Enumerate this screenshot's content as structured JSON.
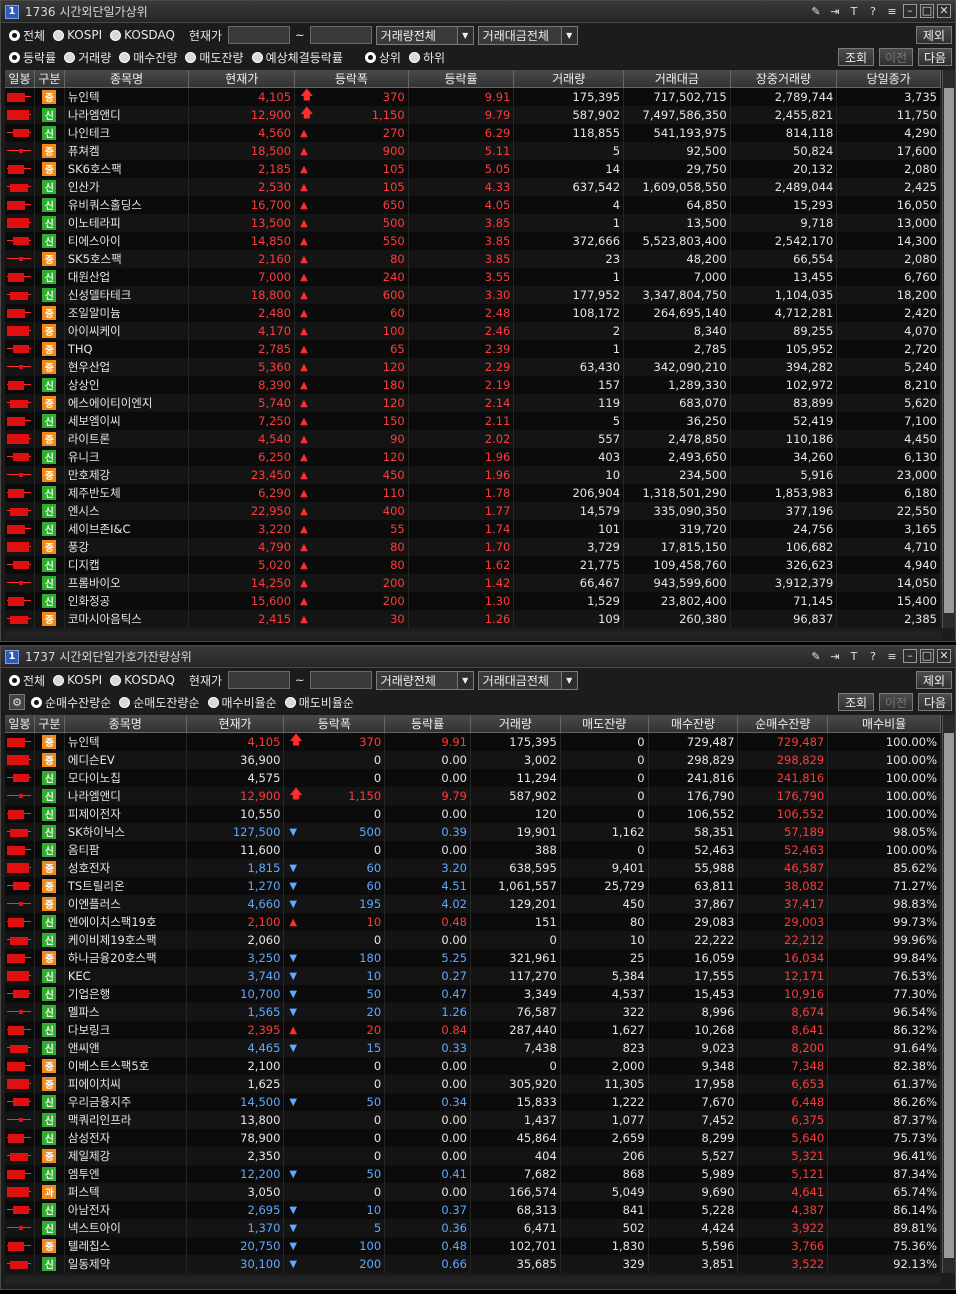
{
  "w1": {
    "title_num": "1",
    "title": "1736 시간외단일가상위",
    "market_options": [
      "전체",
      "KOSPI",
      "KOSDAQ"
    ],
    "price_label": "현재가",
    "range_sep": "~",
    "volume_select": "거래량전체",
    "amount_select": "거래대금전체",
    "exclude_btn": "제외",
    "sort_options": [
      "등락률",
      "거래량",
      "매수잔량",
      "매도잔량",
      "예상체결등락률"
    ],
    "dir_options": [
      "상위",
      "하위"
    ],
    "query_btn": "조회",
    "prev_btn": "이전",
    "next_btn": "다음",
    "headers": [
      "일봉",
      "구분",
      "종목명",
      "현재가",
      "등락폭",
      "등락률",
      "거래량",
      "거래대금",
      "장중거래량",
      "당일종가"
    ],
    "rows": [
      {
        "b": "증",
        "name": "뉴인텍",
        "price": "4,105",
        "arrow": "up",
        "chg": "370",
        "rate": "9.91",
        "vol": "175,395",
        "amt": "717,502,715",
        "dvol": "2,789,744",
        "close": "3,735"
      },
      {
        "b": "신",
        "name": "나라엠앤디",
        "price": "12,900",
        "arrow": "up",
        "chg": "1,150",
        "rate": "9.79",
        "vol": "587,902",
        "amt": "7,497,586,350",
        "dvol": "2,455,821",
        "close": "11,750"
      },
      {
        "b": "신",
        "name": "나인테크",
        "price": "4,560",
        "arrow": "tri",
        "chg": "270",
        "rate": "6.29",
        "vol": "118,855",
        "amt": "541,193,975",
        "dvol": "814,118",
        "close": "4,290"
      },
      {
        "b": "증",
        "name": "퓨쳐켐",
        "price": "18,500",
        "arrow": "tri",
        "chg": "900",
        "rate": "5.11",
        "vol": "5",
        "amt": "92,500",
        "dvol": "50,824",
        "close": "17,600"
      },
      {
        "b": "증",
        "name": "SK6호스팩",
        "price": "2,185",
        "arrow": "tri",
        "chg": "105",
        "rate": "5.05",
        "vol": "14",
        "amt": "29,750",
        "dvol": "20,132",
        "close": "2,080"
      },
      {
        "b": "신",
        "name": "인산가",
        "price": "2,530",
        "arrow": "tri",
        "chg": "105",
        "rate": "4.33",
        "vol": "637,542",
        "amt": "1,609,058,550",
        "dvol": "2,489,044",
        "close": "2,425"
      },
      {
        "b": "신",
        "name": "유비쿼스홀딩스",
        "price": "16,700",
        "arrow": "tri",
        "chg": "650",
        "rate": "4.05",
        "vol": "4",
        "amt": "64,850",
        "dvol": "15,293",
        "close": "16,050"
      },
      {
        "b": "신",
        "name": "이노테라피",
        "price": "13,500",
        "arrow": "tri",
        "chg": "500",
        "rate": "3.85",
        "vol": "1",
        "amt": "13,500",
        "dvol": "9,718",
        "close": "13,000"
      },
      {
        "b": "신",
        "name": "티에스아이",
        "price": "14,850",
        "arrow": "tri",
        "chg": "550",
        "rate": "3.85",
        "vol": "372,666",
        "amt": "5,523,803,400",
        "dvol": "2,542,170",
        "close": "14,300"
      },
      {
        "b": "증",
        "name": "SK5호스팩",
        "price": "2,160",
        "arrow": "tri",
        "chg": "80",
        "rate": "3.85",
        "vol": "23",
        "amt": "48,200",
        "dvol": "66,554",
        "close": "2,080"
      },
      {
        "b": "신",
        "name": "대원산업",
        "price": "7,000",
        "arrow": "tri",
        "chg": "240",
        "rate": "3.55",
        "vol": "1",
        "amt": "7,000",
        "dvol": "13,455",
        "close": "6,760"
      },
      {
        "b": "신",
        "name": "신성델타테크",
        "price": "18,800",
        "arrow": "tri",
        "chg": "600",
        "rate": "3.30",
        "vol": "177,952",
        "amt": "3,347,804,750",
        "dvol": "1,104,035",
        "close": "18,200"
      },
      {
        "b": "증",
        "name": "조일알미늄",
        "price": "2,480",
        "arrow": "tri",
        "chg": "60",
        "rate": "2.48",
        "vol": "108,172",
        "amt": "264,695,140",
        "dvol": "4,712,281",
        "close": "2,420"
      },
      {
        "b": "증",
        "name": "아이씨케이",
        "price": "4,170",
        "arrow": "tri",
        "chg": "100",
        "rate": "2.46",
        "vol": "2",
        "amt": "8,340",
        "dvol": "89,255",
        "close": "4,070"
      },
      {
        "b": "증",
        "name": "THQ",
        "price": "2,785",
        "arrow": "tri",
        "chg": "65",
        "rate": "2.39",
        "vol": "1",
        "amt": "2,785",
        "dvol": "105,952",
        "close": "2,720"
      },
      {
        "b": "증",
        "name": "현우산업",
        "price": "5,360",
        "arrow": "tri",
        "chg": "120",
        "rate": "2.29",
        "vol": "63,430",
        "amt": "342,090,210",
        "dvol": "394,282",
        "close": "5,240"
      },
      {
        "b": "신",
        "name": "상상인",
        "price": "8,390",
        "arrow": "tri",
        "chg": "180",
        "rate": "2.19",
        "vol": "157",
        "amt": "1,289,330",
        "dvol": "102,972",
        "close": "8,210"
      },
      {
        "b": "증",
        "name": "에스에이티이엔지",
        "price": "5,740",
        "arrow": "tri",
        "chg": "120",
        "rate": "2.14",
        "vol": "119",
        "amt": "683,070",
        "dvol": "83,899",
        "close": "5,620"
      },
      {
        "b": "신",
        "name": "세보엠이씨",
        "price": "7,250",
        "arrow": "tri",
        "chg": "150",
        "rate": "2.11",
        "vol": "5",
        "amt": "36,250",
        "dvol": "52,419",
        "close": "7,100"
      },
      {
        "b": "증",
        "name": "라이트론",
        "price": "4,540",
        "arrow": "tri",
        "chg": "90",
        "rate": "2.02",
        "vol": "557",
        "amt": "2,478,850",
        "dvol": "110,186",
        "close": "4,450"
      },
      {
        "b": "신",
        "name": "유니크",
        "price": "6,250",
        "arrow": "tri",
        "chg": "120",
        "rate": "1.96",
        "vol": "403",
        "amt": "2,493,650",
        "dvol": "34,260",
        "close": "6,130"
      },
      {
        "b": "증",
        "name": "만호제강",
        "price": "23,450",
        "arrow": "tri",
        "chg": "450",
        "rate": "1.96",
        "vol": "10",
        "amt": "234,500",
        "dvol": "5,916",
        "close": "23,000"
      },
      {
        "b": "신",
        "name": "제주반도체",
        "price": "6,290",
        "arrow": "tri",
        "chg": "110",
        "rate": "1.78",
        "vol": "206,904",
        "amt": "1,318,501,290",
        "dvol": "1,853,983",
        "close": "6,180"
      },
      {
        "b": "신",
        "name": "엔시스",
        "price": "22,950",
        "arrow": "tri",
        "chg": "400",
        "rate": "1.77",
        "vol": "14,579",
        "amt": "335,090,350",
        "dvol": "377,196",
        "close": "22,550"
      },
      {
        "b": "신",
        "name": "세이브존I&C",
        "price": "3,220",
        "arrow": "tri",
        "chg": "55",
        "rate": "1.74",
        "vol": "101",
        "amt": "319,720",
        "dvol": "24,756",
        "close": "3,165"
      },
      {
        "b": "증",
        "name": "풍강",
        "price": "4,790",
        "arrow": "tri",
        "chg": "80",
        "rate": "1.70",
        "vol": "3,729",
        "amt": "17,815,150",
        "dvol": "106,682",
        "close": "4,710"
      },
      {
        "b": "신",
        "name": "디지캡",
        "price": "5,020",
        "arrow": "tri",
        "chg": "80",
        "rate": "1.62",
        "vol": "21,775",
        "amt": "109,458,760",
        "dvol": "326,623",
        "close": "4,940"
      },
      {
        "b": "신",
        "name": "프롬바이오",
        "price": "14,250",
        "arrow": "tri",
        "chg": "200",
        "rate": "1.42",
        "vol": "66,467",
        "amt": "943,599,600",
        "dvol": "3,912,379",
        "close": "14,050"
      },
      {
        "b": "신",
        "name": "인화정공",
        "price": "15,600",
        "arrow": "tri",
        "chg": "200",
        "rate": "1.30",
        "vol": "1,529",
        "amt": "23,802,400",
        "dvol": "71,145",
        "close": "15,400"
      },
      {
        "b": "증",
        "name": "코마시아음틱스",
        "price": "2,415",
        "arrow": "tri",
        "chg": "30",
        "rate": "1.26",
        "vol": "109",
        "amt": "260,380",
        "dvol": "96,837",
        "close": "2,385"
      }
    ]
  },
  "w2": {
    "title_num": "1",
    "title": "1737 시간외단일가호가잔량상위",
    "market_options": [
      "전체",
      "KOSPI",
      "KOSDAQ"
    ],
    "price_label": "현재가",
    "range_sep": "~",
    "volume_select": "거래량전체",
    "amount_select": "거래대금전체",
    "exclude_btn": "제외",
    "sort_options": [
      "순매수잔량순",
      "순매도잔량순",
      "매수비율순",
      "매도비율순"
    ],
    "query_btn": "조회",
    "prev_btn": "이전",
    "next_btn": "다음",
    "headers": [
      "일봉",
      "구분",
      "종목명",
      "현재가",
      "등락폭",
      "등락률",
      "거래량",
      "매도잔량",
      "매수잔량",
      "순매수잔량",
      "매수비율"
    ],
    "rows": [
      {
        "b": "증",
        "name": "뉴인텍",
        "price": "4,105",
        "pc": "red",
        "arrow": "up",
        "chg": "370",
        "rate": "9.91",
        "vol": "175,395",
        "ask": "0",
        "bid": "729,487",
        "net": "729,487",
        "ratio": "100.00%"
      },
      {
        "b": "증",
        "name": "에디슨EV",
        "price": "36,900",
        "pc": "white",
        "arrow": "",
        "chg": "0",
        "rate": "0.00",
        "vol": "3,002",
        "ask": "0",
        "bid": "298,829",
        "net": "298,829",
        "ratio": "100.00%"
      },
      {
        "b": "신",
        "name": "모다이노칩",
        "price": "4,575",
        "pc": "white",
        "arrow": "",
        "chg": "0",
        "rate": "0.00",
        "vol": "11,294",
        "ask": "0",
        "bid": "241,816",
        "net": "241,816",
        "ratio": "100.00%"
      },
      {
        "b": "신",
        "name": "나라엠앤디",
        "price": "12,900",
        "pc": "red",
        "arrow": "up",
        "chg": "1,150",
        "rate": "9.79",
        "vol": "587,902",
        "ask": "0",
        "bid": "176,790",
        "net": "176,790",
        "ratio": "100.00%"
      },
      {
        "b": "신",
        "name": "피제이전자",
        "price": "10,550",
        "pc": "white",
        "arrow": "",
        "chg": "0",
        "rate": "0.00",
        "vol": "120",
        "ask": "0",
        "bid": "106,552",
        "net": "106,552",
        "ratio": "100.00%"
      },
      {
        "b": "신",
        "name": "SK하이닉스",
        "price": "127,500",
        "pc": "blue",
        "arrow": "down",
        "chg": "500",
        "rate": "0.39",
        "vol": "19,901",
        "ask": "1,162",
        "bid": "58,351",
        "net": "57,189",
        "ratio": "98.05%"
      },
      {
        "b": "신",
        "name": "옴티팜",
        "price": "11,600",
        "pc": "white",
        "arrow": "",
        "chg": "0",
        "rate": "0.00",
        "vol": "388",
        "ask": "0",
        "bid": "52,463",
        "net": "52,463",
        "ratio": "100.00%"
      },
      {
        "b": "증",
        "name": "성호전자",
        "price": "1,815",
        "pc": "blue",
        "arrow": "down",
        "chg": "60",
        "rate": "3.20",
        "vol": "638,595",
        "ask": "9,401",
        "bid": "55,988",
        "net": "46,587",
        "ratio": "85.62%"
      },
      {
        "b": "증",
        "name": "TS트릴리온",
        "price": "1,270",
        "pc": "blue",
        "arrow": "down",
        "chg": "60",
        "rate": "4.51",
        "vol": "1,061,557",
        "ask": "25,729",
        "bid": "63,811",
        "net": "38,082",
        "ratio": "71.27%"
      },
      {
        "b": "증",
        "name": "이엔플러스",
        "price": "4,660",
        "pc": "blue",
        "arrow": "down",
        "chg": "195",
        "rate": "4.02",
        "vol": "129,201",
        "ask": "450",
        "bid": "37,867",
        "net": "37,417",
        "ratio": "98.83%"
      },
      {
        "b": "신",
        "name": "엔에이치스팩19호",
        "price": "2,100",
        "pc": "red",
        "arrow": "tri",
        "chg": "10",
        "rate": "0.48",
        "vol": "151",
        "ask": "80",
        "bid": "29,083",
        "net": "29,003",
        "ratio": "99.73%"
      },
      {
        "b": "신",
        "name": "케이비제19호스팩",
        "price": "2,060",
        "pc": "white",
        "arrow": "",
        "chg": "0",
        "rate": "0.00",
        "vol": "0",
        "ask": "10",
        "bid": "22,222",
        "net": "22,212",
        "ratio": "99.96%"
      },
      {
        "b": "증",
        "name": "하나금융20호스팩",
        "price": "3,250",
        "pc": "blue",
        "arrow": "down",
        "chg": "180",
        "rate": "5.25",
        "vol": "321,961",
        "ask": "25",
        "bid": "16,059",
        "net": "16,034",
        "ratio": "99.84%"
      },
      {
        "b": "신",
        "name": "KEC",
        "price": "3,740",
        "pc": "blue",
        "arrow": "down",
        "chg": "10",
        "rate": "0.27",
        "vol": "117,270",
        "ask": "5,384",
        "bid": "17,555",
        "net": "12,171",
        "ratio": "76.53%"
      },
      {
        "b": "신",
        "name": "기업은행",
        "price": "10,700",
        "pc": "blue",
        "arrow": "down",
        "chg": "50",
        "rate": "0.47",
        "vol": "3,349",
        "ask": "4,537",
        "bid": "15,453",
        "net": "10,916",
        "ratio": "77.30%"
      },
      {
        "b": "신",
        "name": "멜파스",
        "price": "1,565",
        "pc": "blue",
        "arrow": "down",
        "chg": "20",
        "rate": "1.26",
        "vol": "76,587",
        "ask": "322",
        "bid": "8,996",
        "net": "8,674",
        "ratio": "96.54%"
      },
      {
        "b": "신",
        "name": "다보링크",
        "price": "2,395",
        "pc": "red",
        "arrow": "tri",
        "chg": "20",
        "rate": "0.84",
        "vol": "287,440",
        "ask": "1,627",
        "bid": "10,268",
        "net": "8,641",
        "ratio": "86.32%"
      },
      {
        "b": "신",
        "name": "앤씨앤",
        "price": "4,465",
        "pc": "blue",
        "arrow": "down",
        "chg": "15",
        "rate": "0.33",
        "vol": "7,438",
        "ask": "823",
        "bid": "9,023",
        "net": "8,200",
        "ratio": "91.64%"
      },
      {
        "b": "증",
        "name": "이베스트스팩5호",
        "price": "2,100",
        "pc": "white",
        "arrow": "",
        "chg": "0",
        "rate": "0.00",
        "vol": "0",
        "ask": "2,000",
        "bid": "9,348",
        "net": "7,348",
        "ratio": "82.38%"
      },
      {
        "b": "증",
        "name": "피에이치씨",
        "price": "1,625",
        "pc": "white",
        "arrow": "",
        "chg": "0",
        "rate": "0.00",
        "vol": "305,920",
        "ask": "11,305",
        "bid": "17,958",
        "net": "6,653",
        "ratio": "61.37%"
      },
      {
        "b": "신",
        "name": "우리금융지주",
        "price": "14,500",
        "pc": "blue",
        "arrow": "down",
        "chg": "50",
        "rate": "0.34",
        "vol": "15,833",
        "ask": "1,222",
        "bid": "7,670",
        "net": "6,448",
        "ratio": "86.26%"
      },
      {
        "b": "신",
        "name": "맥쿼리인프라",
        "price": "13,800",
        "pc": "white",
        "arrow": "",
        "chg": "0",
        "rate": "0.00",
        "vol": "1,437",
        "ask": "1,077",
        "bid": "7,452",
        "net": "6,375",
        "ratio": "87.37%"
      },
      {
        "b": "신",
        "name": "삼성전자",
        "price": "78,900",
        "pc": "white",
        "arrow": "",
        "chg": "0",
        "rate": "0.00",
        "vol": "45,864",
        "ask": "2,659",
        "bid": "8,299",
        "net": "5,640",
        "ratio": "75.73%"
      },
      {
        "b": "증",
        "name": "제일제강",
        "price": "2,350",
        "pc": "white",
        "arrow": "",
        "chg": "0",
        "rate": "0.00",
        "vol": "404",
        "ask": "206",
        "bid": "5,527",
        "net": "5,321",
        "ratio": "96.41%"
      },
      {
        "b": "신",
        "name": "엠투엔",
        "price": "12,200",
        "pc": "blue",
        "arrow": "down",
        "chg": "50",
        "rate": "0.41",
        "vol": "7,682",
        "ask": "868",
        "bid": "5,989",
        "net": "5,121",
        "ratio": "87.34%"
      },
      {
        "b": "과",
        "name": "퍼스텍",
        "price": "3,050",
        "pc": "white",
        "arrow": "",
        "chg": "0",
        "rate": "0.00",
        "vol": "166,574",
        "ask": "5,049",
        "bid": "9,690",
        "net": "4,641",
        "ratio": "65.74%"
      },
      {
        "b": "신",
        "name": "아남전자",
        "price": "2,695",
        "pc": "blue",
        "arrow": "down",
        "chg": "10",
        "rate": "0.37",
        "vol": "68,313",
        "ask": "841",
        "bid": "5,228",
        "net": "4,387",
        "ratio": "86.14%"
      },
      {
        "b": "신",
        "name": "넥스트아이",
        "price": "1,370",
        "pc": "blue",
        "arrow": "down",
        "chg": "5",
        "rate": "0.36",
        "vol": "6,471",
        "ask": "502",
        "bid": "4,424",
        "net": "3,922",
        "ratio": "89.81%"
      },
      {
        "b": "증",
        "name": "텔레칩스",
        "price": "20,750",
        "pc": "blue",
        "arrow": "down",
        "chg": "100",
        "rate": "0.48",
        "vol": "102,701",
        "ask": "1,830",
        "bid": "5,596",
        "net": "3,766",
        "ratio": "75.36%"
      },
      {
        "b": "신",
        "name": "일동제약",
        "price": "30,100",
        "pc": "blue",
        "arrow": "down",
        "chg": "200",
        "rate": "0.66",
        "vol": "35,685",
        "ask": "329",
        "bid": "3,851",
        "net": "3,522",
        "ratio": "92.13%"
      }
    ]
  },
  "icons": [
    "pin-icon",
    "export-icon",
    "font-icon",
    "help-icon",
    "menu-icon",
    "minimize-icon",
    "maximize-icon",
    "close-icon",
    "settings-icon"
  ],
  "colors": {
    "up": "#ff3b3b",
    "down": "#5fa8ff",
    "badge_new": "#2fae2f",
    "badge_jeung": "#f08a1a"
  }
}
